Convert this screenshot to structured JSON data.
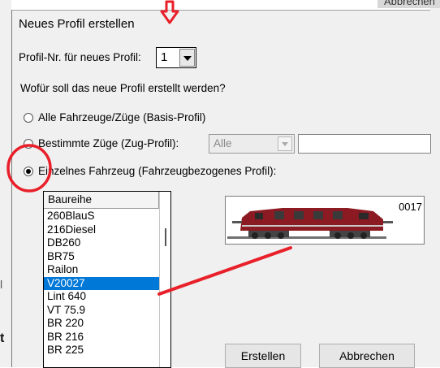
{
  "dialog": {
    "title": "Neues Profil erstellen",
    "profile_number_label": "Profil-Nr. für neues Profil:",
    "profile_number_value": "1",
    "question": "Wofür soll das neue Profil erstellt werden?",
    "options": [
      {
        "label": "Alle Fahrzeuge/Züge (Basis-Profil)",
        "checked": false
      },
      {
        "label": "Bestimmte Züge (Zug-Profil):",
        "checked": false
      },
      {
        "label": "Einzelnes Fahrzeug (Fahrzeugbezogenes Profil):",
        "checked": true
      }
    ],
    "train_filter_value": "Alle",
    "train_text_value": ""
  },
  "list": {
    "header": "Baureihe",
    "items": [
      "260BlauS",
      "216Diesel",
      "DB260",
      "BR75",
      "Railon",
      "V20027",
      "Lint 640",
      "VT 75.9",
      "BR 220",
      "BR 216",
      "BR 225"
    ],
    "selected": "V20027"
  },
  "preview": {
    "vehicle_id": "0017"
  },
  "buttons": {
    "create": "Erstellen",
    "cancel": "Abbrechen"
  },
  "colors": {
    "selection": "#0078d7",
    "annotation": "#e8202a",
    "locomotive": "#8b1a22"
  },
  "background": {
    "top_right_fragment": "Abbrechen",
    "left_fragment_1": "l",
    "left_fragment_2": "t"
  }
}
